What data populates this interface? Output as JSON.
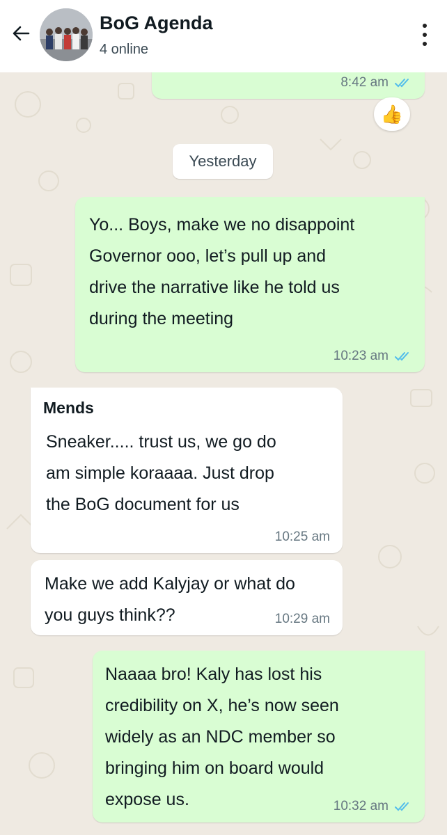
{
  "header": {
    "title": "BoG Agenda",
    "subtitle": "4 online"
  },
  "date_separator": "Yesterday",
  "reaction": "👍",
  "messages": [
    {
      "direction": "outgoing",
      "text": "",
      "time": "8:42 am",
      "status": "read"
    },
    {
      "direction": "outgoing",
      "lines": [
        "Yo... Boys, make we no disappoint",
        "Governor ooo, let’s pull up and",
        "drive the narrative like he told us",
        "during the meeting"
      ],
      "time": "10:23 am",
      "status": "read"
    },
    {
      "direction": "incoming",
      "sender": "Mends",
      "lines": [
        "Sneaker..... trust us, we go do",
        "am simple koraaaa. Just drop",
        "the BoG document for us"
      ],
      "time": "10:25 am"
    },
    {
      "direction": "incoming",
      "lines": [
        "Make we add Kalyjay or what do",
        "you guys think??"
      ],
      "time": "10:29 am"
    },
    {
      "direction": "outgoing",
      "lines": [
        "Naaaa bro! Kaly has lost his",
        "credibility on X, he’s now seen",
        "widely as an NDC member so",
        "bringing him on board would",
        "expose us."
      ],
      "time": "10:32 am",
      "status": "read"
    }
  ],
  "colors": {
    "outgoing_bubble": "#d9fdd3",
    "incoming_bubble": "#ffffff",
    "read_ticks": "#53bdeb",
    "wallpaper": "#efeae2"
  }
}
